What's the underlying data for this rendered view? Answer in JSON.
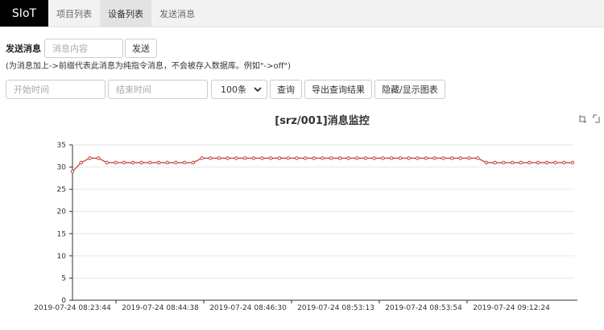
{
  "nav": {
    "brand": "SIoT",
    "tabs": [
      {
        "label": "项目列表",
        "active": false
      },
      {
        "label": "设备列表",
        "active": true
      },
      {
        "label": "发送消息",
        "active": false
      }
    ]
  },
  "send": {
    "label": "发送消息",
    "placeholder": "消息内容",
    "button": "发送",
    "hint": "(为消息加上->前缀代表此消息为纯指令消息，不会被存入数据库。例如\"->off\")"
  },
  "filter": {
    "start_placeholder": "开始时间",
    "end_placeholder": "结束时间",
    "limit": "100条",
    "query_button": "查询",
    "export_button": "导出查询结果",
    "toggle_chart_button": "隐藏/显示图表"
  },
  "toolbox_icons": [
    "restore-icon",
    "save-image-icon"
  ],
  "chart_data": {
    "type": "line",
    "title": "[srz/001]消息监控",
    "ylim": [
      0,
      35
    ],
    "yticks": [
      0,
      5,
      10,
      15,
      20,
      25,
      30,
      35
    ],
    "grid": true,
    "line_color": "#c23531",
    "xtick_labels": [
      "2019-07-24 08:23:44",
      "2019-07-24 08:44:38",
      "2019-07-24 08:46:30",
      "2019-07-24 08:53:13",
      "2019-07-24 08:53:54",
      "2019-07-24 09:12:24"
    ],
    "series": [
      {
        "values": [
          29,
          31,
          32,
          32,
          31,
          31,
          31,
          31,
          31,
          31,
          31,
          31,
          31,
          31,
          31,
          32,
          32,
          32,
          32,
          32,
          32,
          32,
          32,
          32,
          32,
          32,
          32,
          32,
          32,
          32,
          32,
          32,
          32,
          32,
          32,
          32,
          32,
          32,
          32,
          32,
          32,
          32,
          32,
          32,
          32,
          32,
          32,
          32,
          31,
          31,
          31,
          31,
          31,
          31,
          31,
          31,
          31,
          31,
          31
        ]
      }
    ]
  }
}
